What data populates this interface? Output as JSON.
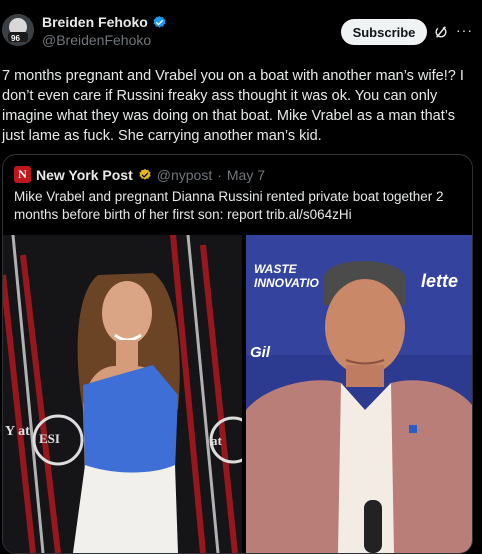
{
  "author": {
    "name": "Breiden Fehoko",
    "handle": "@BreidenFehoko"
  },
  "actions": {
    "subscribe_label": "Subscribe",
    "more_label": "···"
  },
  "tweet": {
    "text": "7 months pregnant and Vrabel you on a boat with another man’s wife!? I don’t even care if Russini freaky ass thought it was ok. You can only imagine what they was doing on that boat. Mike Vrabel as a man that’s just lame as fuck. She carrying another man’s kid."
  },
  "quote": {
    "logo_letter": "N",
    "name": "New York Post",
    "handle": "@nypost",
    "separator": "·",
    "date": "May 7",
    "text": "Mike Vrabel and pregnant Dianna Russini rented private boat together 2 months before birth of her first son: report trib.al/s064zHi"
  },
  "photos": {
    "left_backdrop_text_1": "Y at",
    "left_backdrop_text_2": "ESI",
    "left_backdrop_text_3": "at",
    "right_backdrop_text_1": "WASTE",
    "right_backdrop_text_2": "INNOVATIO",
    "right_backdrop_text_3": "lette",
    "right_backdrop_text_4": "Gil"
  },
  "colors": {
    "background": "#000000",
    "text": "#e7e9ea",
    "muted": "#71767b",
    "verified": "#1d9bf0",
    "nypost_red": "#c2161d",
    "border": "#2f3336"
  }
}
